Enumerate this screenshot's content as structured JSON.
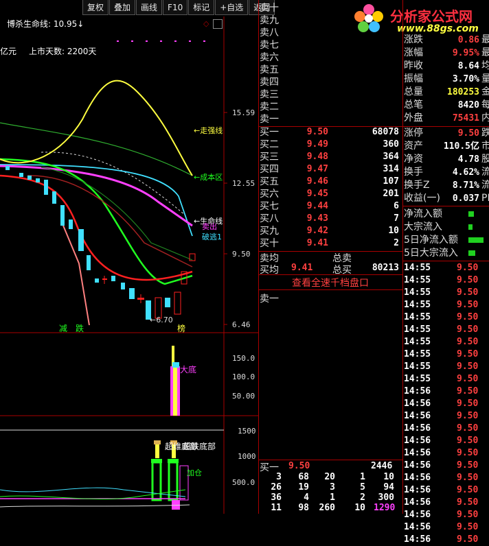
{
  "toolbar": {
    "buttons": [
      "复权",
      "叠加",
      "画线",
      "F10",
      "标记",
      "+自选",
      "返回"
    ]
  },
  "chart": {
    "indicator_title": "博杀生命线: 10.95",
    "indicator_arrow": "↓",
    "sub_text_left": "亿元",
    "listing_days": "上市天数: 2200天",
    "price_ticks": [
      "15.59",
      "12.55",
      "9.50",
      "6.46"
    ],
    "vol_ticks": [
      "150.0",
      "100.0",
      "50.00"
    ],
    "osc_ticks": [
      "1500",
      "1000",
      "500.0"
    ],
    "annotations": {
      "strong": "←走强线",
      "cost": "←成本区",
      "life": "←生命线",
      "exit": "卖出",
      "break": "破逃1",
      "low_price": "←6.70",
      "reduce": "减",
      "fall": "跌",
      "rank": "榜",
      "bottom": "大底",
      "bottom2": "超维底部",
      "bottom3": "超跌底部",
      "add": "加仓"
    },
    "colors": {
      "yellow": "#ffff40",
      "green": "#40ff40",
      "red": "#ff2020",
      "magenta": "#ff40ff",
      "cyan": "#40e0ff",
      "pink": "#ff8080"
    }
  },
  "logo": {
    "brand": "分析家公式网",
    "url": "www.88gs.com"
  },
  "order_book": {
    "asks": [
      {
        "label": "卖十",
        "price": "",
        "vol": ""
      },
      {
        "label": "卖九",
        "price": "",
        "vol": ""
      },
      {
        "label": "卖八",
        "price": "",
        "vol": ""
      },
      {
        "label": "卖七",
        "price": "",
        "vol": ""
      },
      {
        "label": "卖六",
        "price": "",
        "vol": ""
      },
      {
        "label": "卖五",
        "price": "",
        "vol": ""
      },
      {
        "label": "卖四",
        "price": "",
        "vol": ""
      },
      {
        "label": "卖三",
        "price": "",
        "vol": ""
      },
      {
        "label": "卖二",
        "price": "",
        "vol": ""
      },
      {
        "label": "卖一",
        "price": "",
        "vol": ""
      }
    ],
    "bids": [
      {
        "label": "买一",
        "price": "9.50",
        "vol": "68078"
      },
      {
        "label": "买二",
        "price": "9.49",
        "vol": "360"
      },
      {
        "label": "买三",
        "price": "9.48",
        "vol": "364"
      },
      {
        "label": "买四",
        "price": "9.47",
        "vol": "314"
      },
      {
        "label": "买五",
        "price": "9.46",
        "vol": "107"
      },
      {
        "label": "买六",
        "price": "9.45",
        "vol": "201"
      },
      {
        "label": "买七",
        "price": "9.44",
        "vol": "6"
      },
      {
        "label": "买八",
        "price": "9.43",
        "vol": "7"
      },
      {
        "label": "买九",
        "price": "9.42",
        "vol": "10"
      },
      {
        "label": "买十",
        "price": "9.41",
        "vol": "2"
      }
    ],
    "avg_sell_label": "卖均",
    "total_sell_label": "总卖",
    "avg_buy_label": "买均",
    "avg_buy_price": "9.41",
    "total_buy_label": "总买",
    "total_buy_vol": "80213",
    "full_depth_link": "查看全速千档盘口",
    "queue_sell_label": "卖一",
    "queue_buy_label": "买一",
    "queue_buy_price": "9.50",
    "queue_buy_vol": "2446",
    "queue_grid": [
      [
        "3",
        "68",
        "20",
        "1",
        "10"
      ],
      [
        "26",
        "19",
        "3",
        "5",
        "94"
      ],
      [
        "36",
        "4",
        "1",
        "2",
        "300"
      ],
      [
        "11",
        "98",
        "260",
        "10",
        "1290"
      ]
    ]
  },
  "stats": {
    "rows": [
      {
        "label": "现价",
        "val": "",
        "extra": "",
        "color": "#ff4040"
      },
      {
        "label": "涨跌",
        "val": "0.86",
        "extra": "最",
        "color": "#ff4040"
      },
      {
        "label": "涨幅",
        "val": "9.95%",
        "extra": "最",
        "color": "#ff4040"
      },
      {
        "label": "昨收",
        "val": "8.64",
        "extra": "均",
        "color": "#ffffff"
      },
      {
        "label": "振幅",
        "val": "3.70%",
        "extra": "量",
        "color": "#ffffff"
      },
      {
        "label": "总量",
        "val": "180253",
        "extra": "金",
        "color": "#ffff40"
      },
      {
        "label": "总笔",
        "val": "8420",
        "extra": "每",
        "color": "#ffffff"
      },
      {
        "label": "外盘",
        "val": "75431",
        "extra": "内",
        "color": "#ff4040"
      },
      {
        "label": "涨停",
        "val": "9.50",
        "extra": "跌",
        "color": "#ff4040"
      },
      {
        "label": "资产",
        "val": "110.5亿",
        "extra": "市",
        "color": "#ffffff"
      },
      {
        "label": "净资",
        "val": "4.78",
        "extra": "股",
        "color": "#ffffff"
      },
      {
        "label": "换手",
        "val": "4.62%",
        "extra": "流",
        "color": "#ffffff"
      },
      {
        "label": "换手Z",
        "val": "8.71%",
        "extra": "流",
        "color": "#ffffff"
      },
      {
        "label": "收益(一)",
        "val": "0.037",
        "extra": "PE",
        "color": "#ffffff"
      }
    ],
    "flows": [
      "净流入额",
      "大宗流入",
      "5日净流入额",
      "5日大宗流入"
    ],
    "ticks": [
      {
        "t": "14:55",
        "p": "9.50"
      },
      {
        "t": "14:55",
        "p": "9.50"
      },
      {
        "t": "14:55",
        "p": "9.50"
      },
      {
        "t": "14:55",
        "p": "9.50"
      },
      {
        "t": "14:55",
        "p": "9.50"
      },
      {
        "t": "14:55",
        "p": "9.50"
      },
      {
        "t": "14:55",
        "p": "9.50"
      },
      {
        "t": "14:55",
        "p": "9.50"
      },
      {
        "t": "14:55",
        "p": "9.50"
      },
      {
        "t": "14:55",
        "p": "9.50"
      },
      {
        "t": "14:56",
        "p": "9.50"
      },
      {
        "t": "14:56",
        "p": "9.50"
      },
      {
        "t": "14:56",
        "p": "9.50"
      },
      {
        "t": "14:56",
        "p": "9.50"
      },
      {
        "t": "14:56",
        "p": "9.50"
      },
      {
        "t": "14:56",
        "p": "9.50"
      },
      {
        "t": "14:56",
        "p": "9.50"
      },
      {
        "t": "14:56",
        "p": "9.50"
      },
      {
        "t": "14:56",
        "p": "9.50"
      },
      {
        "t": "14:56",
        "p": "9.50"
      },
      {
        "t": "14:56",
        "p": "9.50"
      },
      {
        "t": "14:56",
        "p": "9.50"
      },
      {
        "t": "14:56",
        "p": "9.50"
      }
    ]
  }
}
